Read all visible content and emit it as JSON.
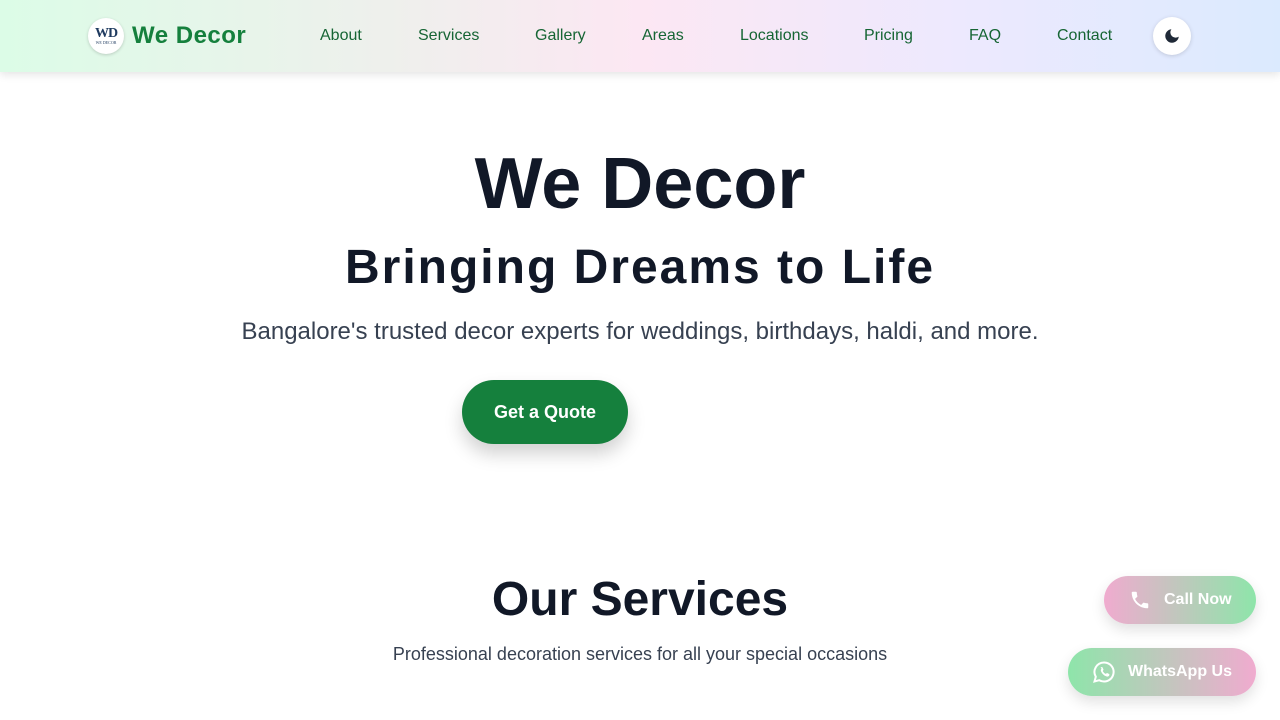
{
  "brand": {
    "logo_text": "WD",
    "logo_subtext": "WE DECOR",
    "name": "We Decor"
  },
  "nav": {
    "links": [
      "About",
      "Services",
      "Gallery",
      "Areas",
      "Locations",
      "Pricing",
      "FAQ",
      "Contact"
    ],
    "theme_toggle_icon": "moon-icon"
  },
  "hero": {
    "title": "We Decor",
    "subtitle": "Bringing Dreams to Life",
    "description": "Bangalore's trusted decor experts for weddings, birthdays, haldi, and more.",
    "cta_label": "Get a Quote"
  },
  "services": {
    "title": "Our Services",
    "description": "Professional decoration services for all your special occasions"
  },
  "floating": {
    "call_label": "Call Now",
    "call_icon": "phone-icon",
    "whatsapp_label": "WhatsApp Us",
    "whatsapp_icon": "whatsapp-icon"
  },
  "colors": {
    "brand_green": "#15803d",
    "nav_text": "#166534",
    "heading": "#111827",
    "body_text": "#374151"
  }
}
